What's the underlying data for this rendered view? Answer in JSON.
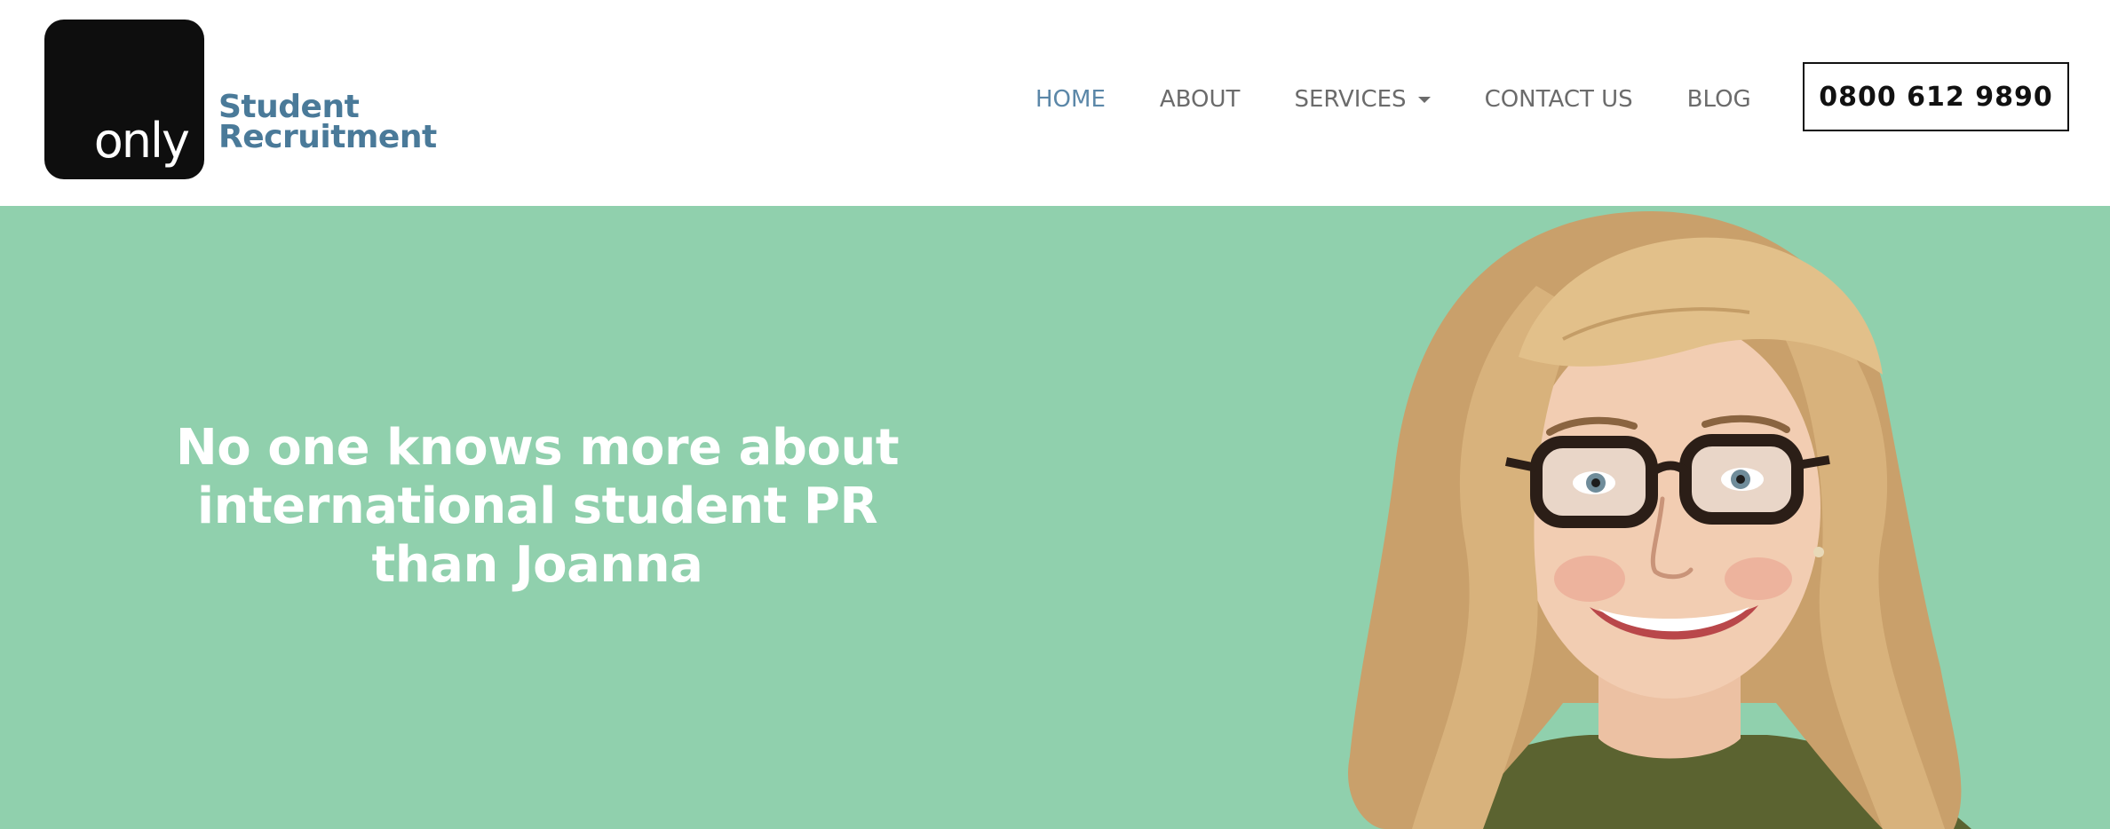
{
  "header": {
    "logo": {
      "mark_text": "only",
      "line1": "Student",
      "line2": "Recruitment"
    },
    "nav": [
      {
        "label": "HOME",
        "active": true
      },
      {
        "label": "ABOUT",
        "active": false
      },
      {
        "label": "SERVICES",
        "active": false,
        "has_dropdown": true
      },
      {
        "label": "CONTACT US",
        "active": false
      },
      {
        "label": "BLOG",
        "active": false
      }
    ],
    "phone": "0800 612 9890"
  },
  "hero": {
    "headline": "No one knows more about international student PR than Joanna",
    "portrait_icon": "smiling-woman-portrait"
  },
  "colors": {
    "brand_blue": "#4a7a99",
    "nav_active": "#5b87a8",
    "nav_text": "#6b6b6b",
    "hero_bg": "#90d0ad",
    "logo_bg": "#0e0e0e"
  }
}
